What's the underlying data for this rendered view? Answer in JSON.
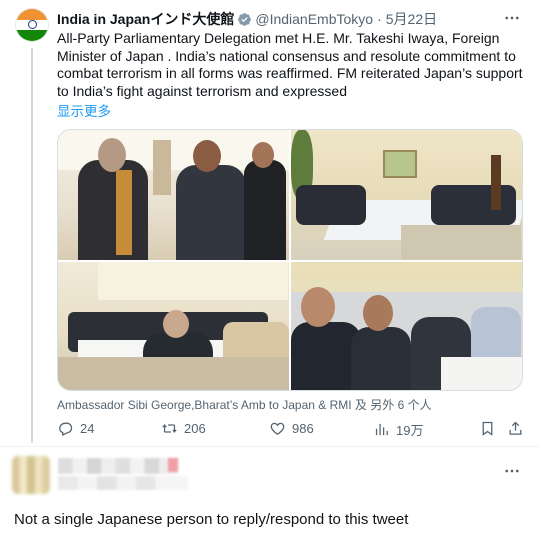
{
  "tweet": {
    "display_name": "India in Japanインド大使館",
    "handle": "@IndianEmbTokyo",
    "separator": "·",
    "date": "5月22日",
    "text": "All-Party Parliamentary Delegation met  H.E. Mr. Takeshi Iwaya, Foreign Minister of Japan . India’s national consensus and resolute commitment to combat terrorism in all forms was reaffirmed. FM reiterated Japan’s support to India’s fight against terrorism and expressed",
    "show_more": "显示更多",
    "avatar_icon": "india-flag-icon",
    "verified_icon": "verified-badge-icon",
    "colors": {
      "link": "#1d9bf0",
      "muted": "#536471",
      "verified": "#829aab"
    }
  },
  "media": {
    "photos": [
      {
        "name": "photo-1"
      },
      {
        "name": "photo-2"
      },
      {
        "name": "photo-3"
      },
      {
        "name": "photo-4"
      }
    ],
    "tagged": "Ambassador Sibi George,Bharat’s Amb to Japan & RMI 及 另外 6 个人"
  },
  "actions": {
    "replies": "24",
    "retweets": "206",
    "likes": "986",
    "views": "19万"
  },
  "reply": {
    "more_icon": "more-horizontal-icon"
  },
  "caption": "Not a single Japanese person to reply/respond to this tweet"
}
